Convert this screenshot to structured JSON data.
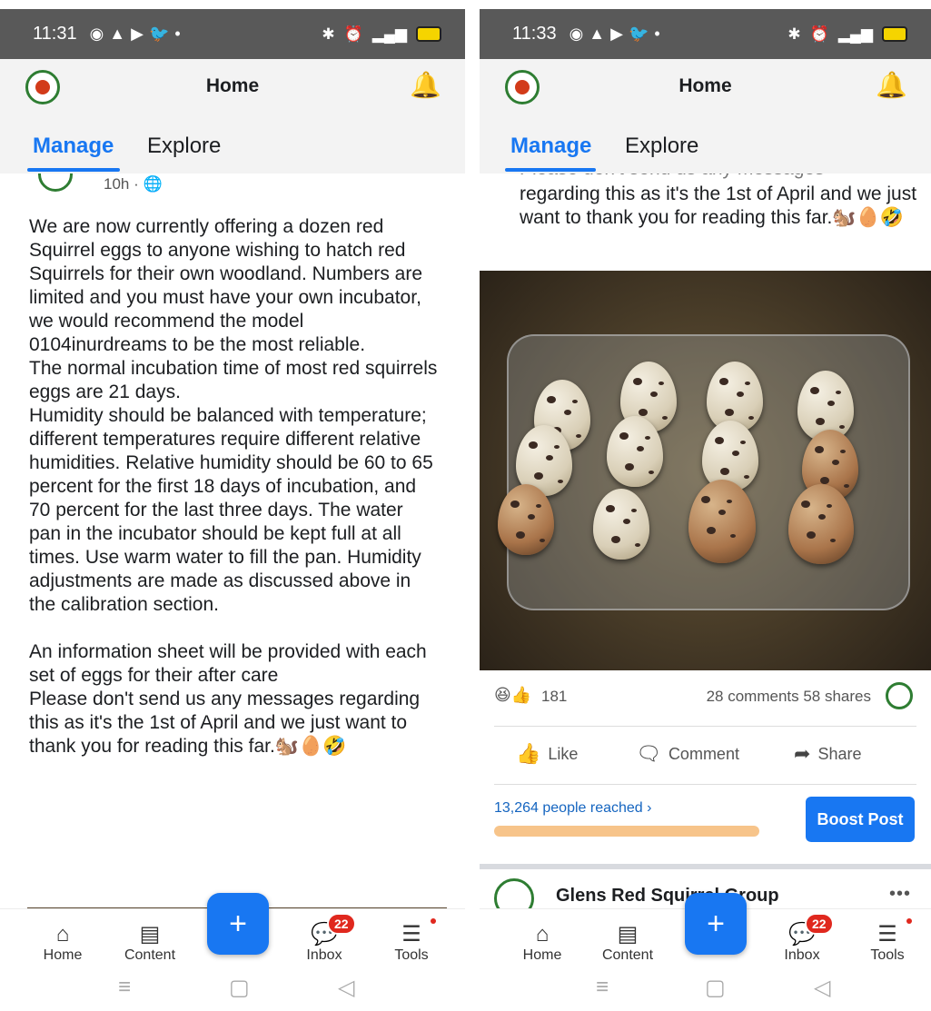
{
  "status_bar": {
    "time_left": "11:31",
    "time_right": "11:33",
    "notif_icons": [
      "whatsapp-icon",
      "snapchat-icon",
      "youtube-icon",
      "twitter-icon"
    ],
    "system_icons": [
      "bluetooth-icon",
      "mute-icon",
      "alarm-icon",
      "wifi-icon",
      "signal-icon",
      "battery-icon"
    ]
  },
  "app_bar": {
    "title": "Home"
  },
  "tabs": [
    {
      "label": "Manage",
      "active": true
    },
    {
      "label": "Explore",
      "active": false
    }
  ],
  "left_post": {
    "age": "10h · 🌐",
    "text": "We are now currently offering a dozen red Squirrel eggs to anyone wishing to hatch red Squirrels for their own woodland. Numbers are limited and you must have your own incubator, we would recommend the model 0104inurdreams to be the most reliable.\nThe normal incubation time of most red squirrels eggs are 21 days.\nHumidity should be balanced with temperature; different temperatures require different relative humidities. Relative humidity should be 60 to 65 percent for the first 18 days of incubation, and 70 percent for the last three days. The water pan in the incubator should be kept full at all times. Use warm water to fill the pan. Humidity adjustments are made as discussed above in the calibration section.\n\nAn information sheet will be provided with each set of eggs for their after care\nPlease don't send us any messages regarding this as it's the 1st of April and we just want to thank you for reading this far.🐿️🥚🤣"
  },
  "right_post": {
    "cut_line": "Please don't send us any messages",
    "text": "regarding this as it's the 1st of April and we just want to thank you for reading this far.🐿️🥚🤣",
    "reactions": {
      "icons": "😆👍",
      "count": "181"
    },
    "comments_shares": "28 comments 58 shares",
    "actions": {
      "like": "Like",
      "comment": "Comment",
      "share": "Share"
    },
    "reach": "13,264 people reached ›",
    "boost": "Boost Post"
  },
  "next_post": {
    "name": "Glens Red Squirrel Group",
    "more": "•••"
  },
  "bottom_nav": {
    "home": "Home",
    "content": "Content",
    "fab": "+",
    "inbox": "Inbox",
    "inbox_badge": "22",
    "tools": "Tools"
  },
  "system_nav": {
    "recents": "≡",
    "home": "▢",
    "back": "◁"
  },
  "colors": {
    "accent": "#1877f2",
    "status_bar": "#595959",
    "badge": "#e0281e",
    "reach_bar": "#f7c48a"
  }
}
